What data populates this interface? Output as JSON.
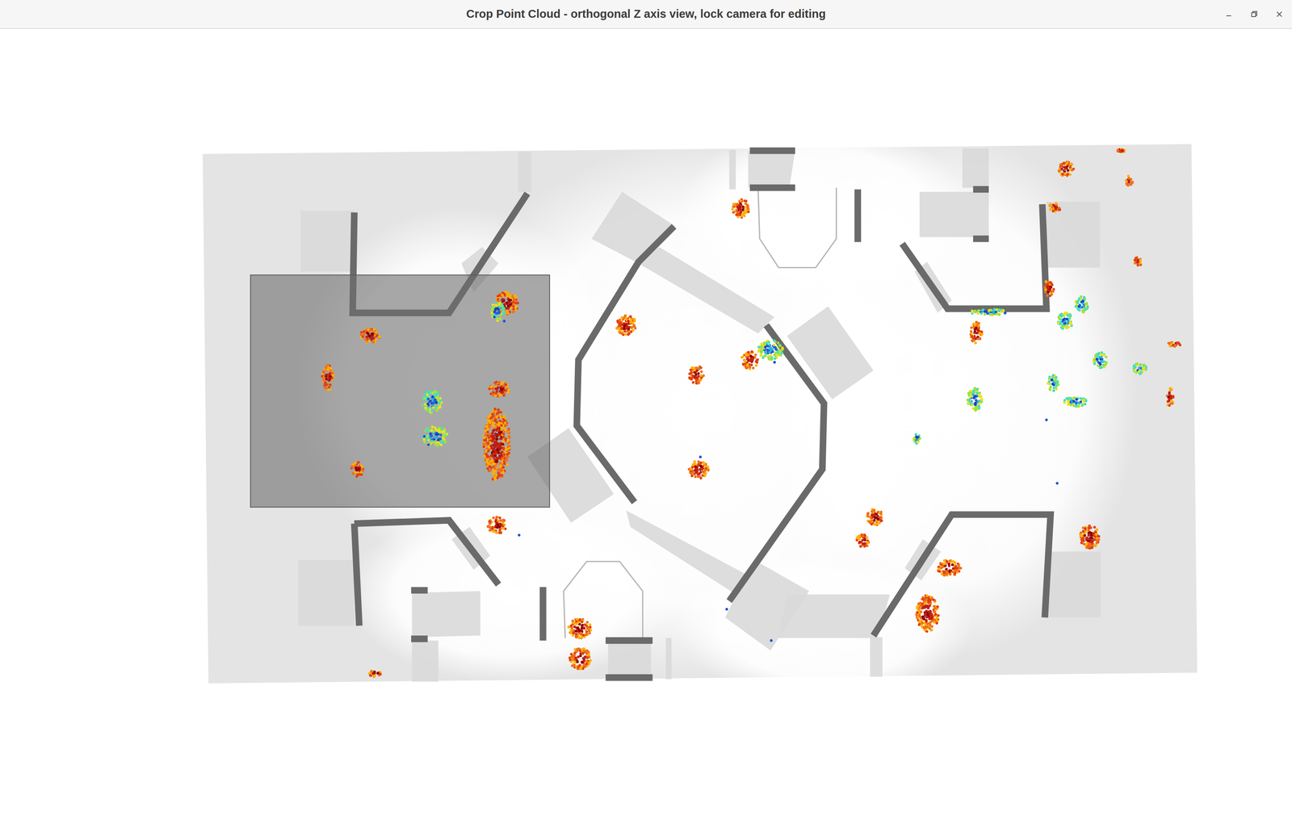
{
  "window": {
    "title": "Crop Point Cloud - orthogonal Z axis view, lock camera for editing"
  }
}
